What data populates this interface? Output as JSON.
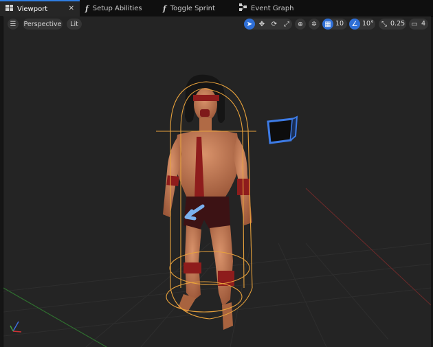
{
  "tabs": [
    {
      "label": "Viewport",
      "icon": "viewport-grid-icon",
      "active": true
    },
    {
      "label": "Setup Abilities",
      "icon": "function-icon"
    },
    {
      "label": "Toggle Sprint",
      "icon": "function-icon"
    },
    {
      "label": "Event Graph",
      "icon": "event-graph-icon"
    }
  ],
  "tab_close": "✕",
  "toolbar": {
    "menu_icon": "hamburger-menu-icon",
    "perspective_label": "Perspective",
    "lit_label": "Lit",
    "grid_snap_value": "10",
    "rotation_snap_value": "10°",
    "scale_snap_value": "0.25",
    "camera_speed_value": "4"
  },
  "colors": {
    "accent": "#2f6fd6",
    "capsule": "#e8a23c",
    "body_paint": "#8e1c1c",
    "background": "#242424"
  }
}
